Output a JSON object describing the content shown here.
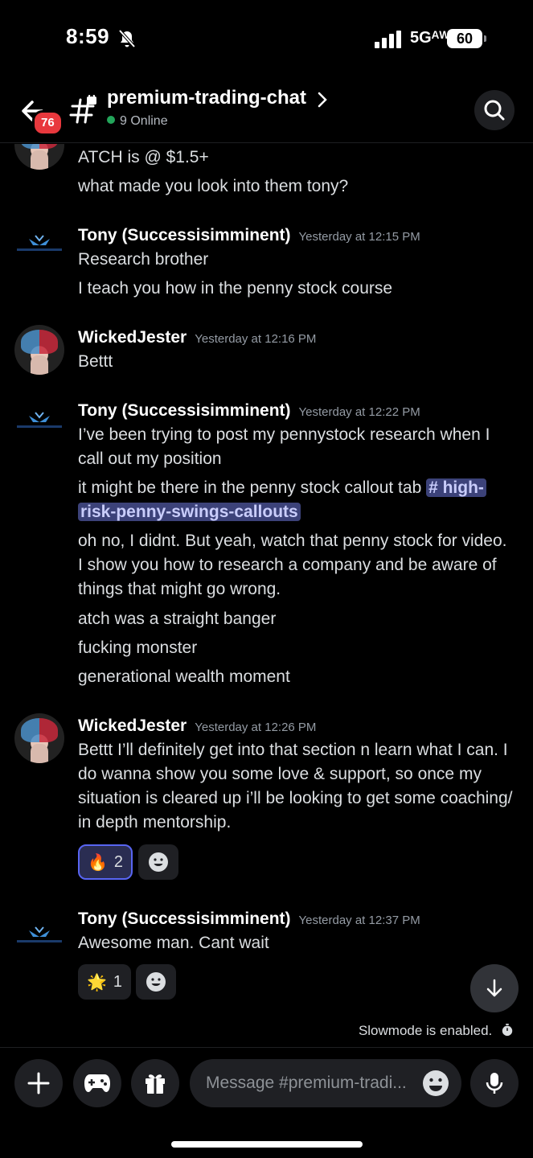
{
  "status_bar": {
    "time": "8:59",
    "network": "5Gᴬᵂ",
    "battery": "60"
  },
  "header": {
    "unread_badge": "76",
    "channel_name": "premium-trading-chat",
    "online": "9 Online"
  },
  "messages": [
    {
      "lines": [
        "ATCH is @ $1.5+",
        "what made you look into them tony?"
      ]
    },
    {
      "author": "Tony (Successisimminent)",
      "time": "Yesterday at 12:15 PM",
      "lines": [
        "Research brother",
        "I teach you how in the penny stock course"
      ]
    },
    {
      "author": "WickedJester",
      "time": "Yesterday at 12:16 PM",
      "lines": [
        "Bettt"
      ]
    },
    {
      "author": "Tony (Successisimminent)",
      "time": "Yesterday at 12:22 PM",
      "lines": [
        "I’ve been trying to post my pennystock research when I call out my position",
        "it might be there in the penny stock callout tab",
        "oh no, I didnt. But yeah, watch that penny stock for video. I show you how to research a company and be aware of things that might go wrong.",
        "atch was a straight banger",
        "fucking monster",
        "generational wealth moment"
      ],
      "mention_a": "# high-",
      "mention_b": "risk-penny-swings-callouts"
    },
    {
      "author": "WickedJester",
      "time": "Yesterday at 12:26 PM",
      "lines": [
        "Bettt I’ll definitely get into that section n learn what I can. I do wanna show you some love & support, so once my situation is cleared up i’ll be looking to get some coaching/ in depth mentorship."
      ],
      "reaction": {
        "emoji": "🔥",
        "count": "2"
      }
    },
    {
      "author": "Tony (Successisimminent)",
      "time": "Yesterday at 12:37 PM",
      "lines": [
        "Awesome man. Cant wait"
      ],
      "reaction": {
        "emoji": "🌟",
        "count": "1"
      }
    }
  ],
  "slowmode": "Slowmode is enabled.",
  "composer": {
    "placeholder": "Message #premium-tradi..."
  },
  "colors": {
    "accent": "#5865f2",
    "online": "#23a55a",
    "badge": "#e8383d",
    "mention_bg": "#3c4279"
  }
}
